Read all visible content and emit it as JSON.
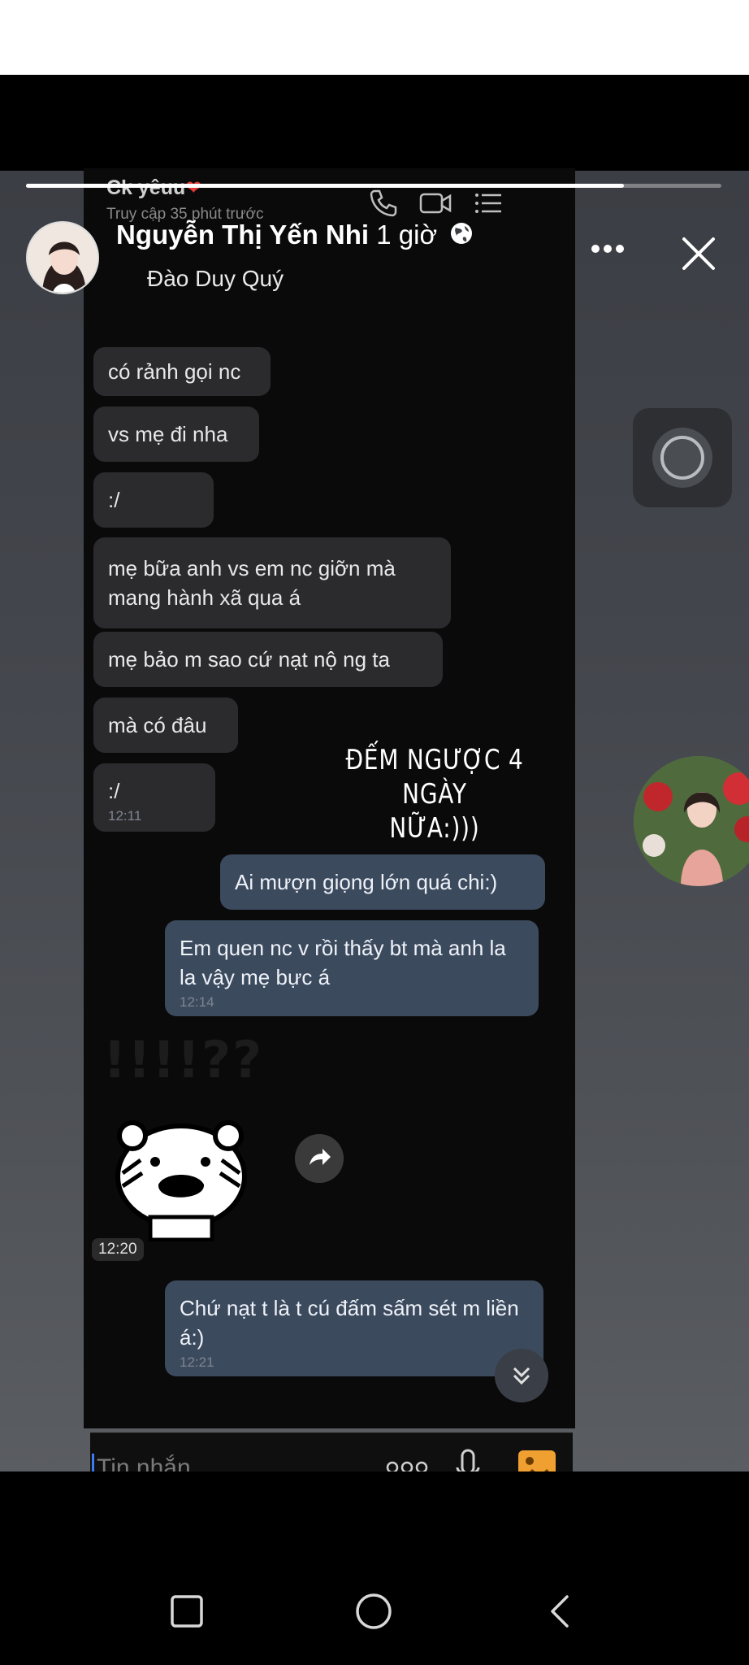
{
  "story": {
    "poster_name": "Nguyễn Thị Yến Nhi",
    "time": "1 giờ",
    "tagged_user": "Đào Duy Quý",
    "overlay_text_line1": "ĐẾM NGƯỢC 4 NGÀY",
    "overlay_text_line2": "NỮA:)))",
    "progress_fraction": 0.86
  },
  "chat": {
    "contact_name": "Ck yêuu",
    "status": "Truy cập 35 phút trước",
    "messages_in": [
      {
        "text": "có rảnh gọi nc"
      },
      {
        "text": "vs mẹ đi nha"
      },
      {
        "text": ":/"
      },
      {
        "text": "mẹ bữa anh vs em nc giỡn mà mang hành xã qua á"
      },
      {
        "text": "mẹ bảo m sao cứ nạt nộ ng ta"
      },
      {
        "text": "mà có đâu"
      },
      {
        "text": ":/",
        "time": "12:11"
      }
    ],
    "messages_out": [
      {
        "text": "Ai mượn giọng lớn quá chi:)"
      },
      {
        "text": "Em quen nc v rồi thấy bt mà anh la la vậy mẹ bực á",
        "time": "12:14"
      },
      {
        "text": "Chứ nạt t là t cú đấm sấm sét m liền á:)",
        "time": "12:21"
      }
    ],
    "sticker_caption": "!!!!??",
    "sticker_time": "12:20",
    "input_placeholder": "Tin nhắn"
  },
  "colors": {
    "incoming_bubble": "#2b2b2d",
    "outgoing_bubble": "#3c4a5e",
    "accent_gallery": "#f0a030"
  },
  "icons": [
    "phone-icon",
    "video-icon",
    "list-icon",
    "globe-icon",
    "more-icon",
    "close-icon",
    "share-icon",
    "scroll-down-icon",
    "more-dots-icon",
    "mic-icon",
    "gallery-icon",
    "recent-apps-icon",
    "home-icon",
    "back-icon"
  ]
}
